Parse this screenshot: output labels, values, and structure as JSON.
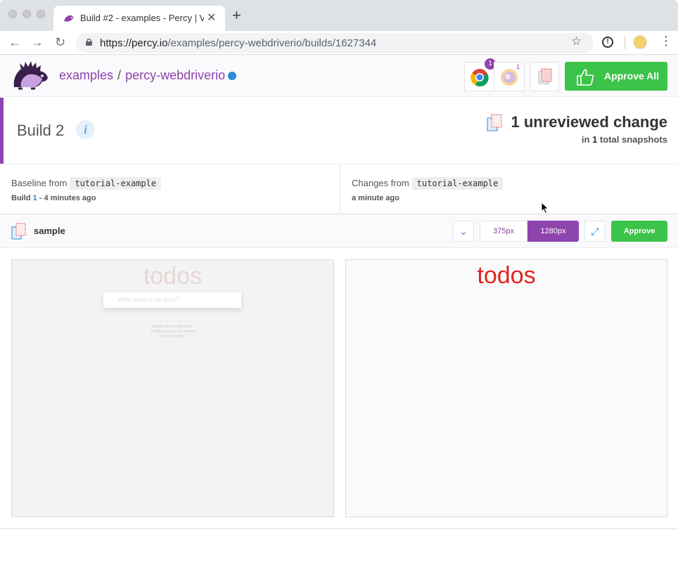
{
  "browser": {
    "tab_title": "Build #2 - examples - Percy | V",
    "tab_close": "✕",
    "new_tab": "+",
    "url_host": "https://percy.io",
    "url_path": "/examples/percy-webdriverio/builds/1627344"
  },
  "header": {
    "org": "examples",
    "separator": "/",
    "project": "percy-webdriverio",
    "chrome_badge": "1",
    "firefox_count": "1",
    "approve_all_label": "Approve All"
  },
  "build": {
    "title": "Build 2",
    "info": "i",
    "unreviewed": "1 unreviewed change",
    "total_prefix": "in",
    "total_count": "1",
    "total_suffix": "total snapshots"
  },
  "compare": {
    "baseline_label": "Baseline from",
    "baseline_branch": "tutorial-example",
    "baseline_build_prefix": "Build",
    "baseline_build_number": "1",
    "baseline_time": "- 4 minutes ago",
    "changes_label": "Changes from",
    "changes_branch": "tutorial-example",
    "changes_time": "a minute ago"
  },
  "snapshot": {
    "name": "sample",
    "width_375": "375px",
    "width_1280": "1280px",
    "approve_label": "Approve"
  },
  "preview": {
    "left_title": "todos",
    "left_placeholder": "What needs to be done?",
    "right_title": "todos",
    "right_placeholder": "What needs to be done?",
    "footer_lines": [
      "Double-click to edit a todo",
      "Created by Remo H. Jansen",
      "Part of TodoMVC"
    ]
  },
  "colors": {
    "brand": "#8e44ad",
    "approve": "#3cc34a",
    "link": "#2a8bd8",
    "todos_red": "#e0261e"
  }
}
